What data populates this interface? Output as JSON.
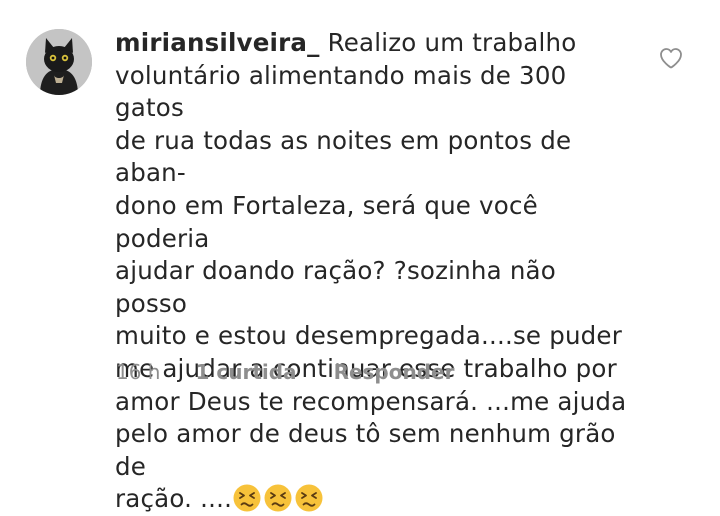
{
  "comment": {
    "username": "miriansilveira_",
    "text": " Realizo um trabalho\nvoluntário alimentando mais de 300 gatos\nde rua todas as noites em pontos de aban-\ndono em Fortaleza,  será que você poderia\najudar doando ração? ?sozinha não posso\nmuito e estou desempregada....se puder\nme ajudar a continuar esse trabalho por\namor Deus te recompensará. ...me ajuda\npelo amor de deus tô sem nenhum grão de\nração. ....",
    "emojis": [
      "persevering-face-emoji",
      "persevering-face-emoji",
      "persevering-face-emoji"
    ],
    "time": "16 h",
    "likes": "1 curtida",
    "reply_label": "Responder"
  },
  "icons": {
    "like": "heart-outline-icon",
    "avatar": "black-cat-avatar"
  },
  "colors": {
    "text": "#262626",
    "meta": "#8e8e8e",
    "heart_outline": "#8e8e8e",
    "emoji_face": "#f7c23a"
  }
}
